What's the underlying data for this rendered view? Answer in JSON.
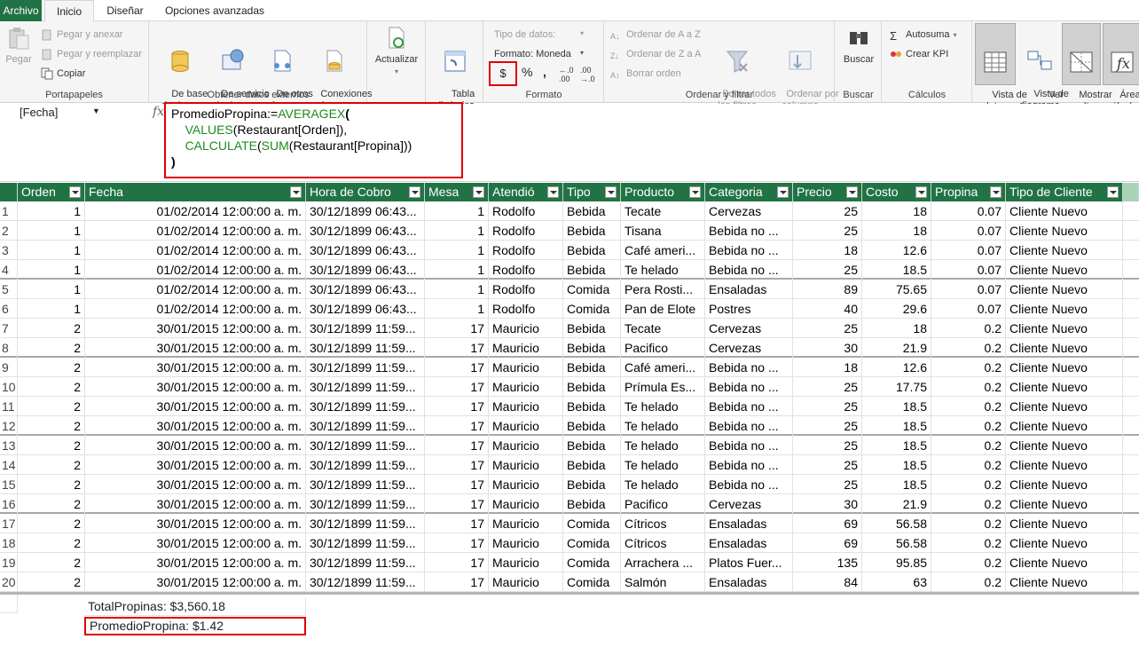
{
  "tabs": {
    "file": "Archivo",
    "home": "Inicio",
    "design": "Diseñar",
    "advanced": "Opciones avanzadas"
  },
  "ribbon": {
    "clipboard": {
      "paste": "Pegar",
      "paste_append": "Pegar y anexar",
      "paste_replace": "Pegar y reemplazar",
      "copy": "Copiar",
      "label": "Portapapeles"
    },
    "external": {
      "from_db": "De base\nde datos",
      "from_service": "De servicio\nde datos",
      "from_other": "De otros\norígenes",
      "existing": "Conexiones\nexistentes",
      "label": "Obtener datos externos"
    },
    "refresh": "Actualizar",
    "pivot": "Tabla\ndinámica",
    "format": {
      "data_type": "Tipo de datos:",
      "format": "Formato: Moneda",
      "currency": "$",
      "percent": "%",
      "comma": "͗",
      "label": "Formato"
    },
    "sort": {
      "asc": "Ordenar de A a Z",
      "desc": "Ordenar de Z a A",
      "clear": "Borrar orden",
      "clear_filters": "Borrar todos\nlos filtros",
      "by_column": "Ordenar por\ncolumna",
      "label": "Ordenar y filtrar"
    },
    "find": {
      "find": "Buscar",
      "label": "Buscar"
    },
    "calc": {
      "autosum": "Autosuma",
      "kpi": "Crear KPI",
      "label": "Cálculos"
    },
    "view": {
      "data_view": "Vista de\ndatos",
      "diagram_view": "Vista de\ndiagrama",
      "show_hidden": "Mostrar\noculto",
      "calc_area": "Área de\ncálculo",
      "label": "Ver"
    }
  },
  "formula_bar": {
    "name_box": "[Fecha]",
    "line1_name": "PromedioPropina:=",
    "line1_fn": "AVERAGEX",
    "line1_end": "(",
    "line2_fn": "VALUES",
    "line2_arg": "(Restaurant[Orden]),",
    "line3_fn1": "CALCULATE",
    "line3_mid": "(",
    "line3_fn2": "SUM",
    "line3_arg": "(Restaurant[Propina]))",
    "line4": ")"
  },
  "columns": [
    "Orden",
    "Fecha",
    "Hora de Cobro",
    "Mesa",
    "Atendió",
    "Tipo",
    "Producto",
    "Categoria",
    "Precio",
    "Costo",
    "Propina",
    "Tipo de Cliente"
  ],
  "rows": [
    [
      "1",
      "1",
      "01/02/2014 12:00:00 a. m.",
      "30/12/1899 06:43...",
      "1",
      "Rodolfo",
      "Bebida",
      "Tecate",
      "Cervezas",
      "25",
      "18",
      "0.07",
      "Cliente Nuevo"
    ],
    [
      "2",
      "1",
      "01/02/2014 12:00:00 a. m.",
      "30/12/1899 06:43...",
      "1",
      "Rodolfo",
      "Bebida",
      "Tisana",
      "Bebida no ...",
      "25",
      "18",
      "0.07",
      "Cliente Nuevo"
    ],
    [
      "3",
      "1",
      "01/02/2014 12:00:00 a. m.",
      "30/12/1899 06:43...",
      "1",
      "Rodolfo",
      "Bebida",
      "Café ameri...",
      "Bebida no ...",
      "18",
      "12.6",
      "0.07",
      "Cliente Nuevo"
    ],
    [
      "4",
      "1",
      "01/02/2014 12:00:00 a. m.",
      "30/12/1899 06:43...",
      "1",
      "Rodolfo",
      "Bebida",
      "Te helado",
      "Bebida no ...",
      "25",
      "18.5",
      "0.07",
      "Cliente Nuevo"
    ],
    [
      "5",
      "1",
      "01/02/2014 12:00:00 a. m.",
      "30/12/1899 06:43...",
      "1",
      "Rodolfo",
      "Comida",
      "Pera Rosti...",
      "Ensaladas",
      "89",
      "75.65",
      "0.07",
      "Cliente Nuevo"
    ],
    [
      "6",
      "1",
      "01/02/2014 12:00:00 a. m.",
      "30/12/1899 06:43...",
      "1",
      "Rodolfo",
      "Comida",
      "Pan de Elote",
      "Postres",
      "40",
      "29.6",
      "0.07",
      "Cliente Nuevo"
    ],
    [
      "7",
      "2",
      "30/01/2015 12:00:00 a. m.",
      "30/12/1899 11:59...",
      "17",
      "Mauricio",
      "Bebida",
      "Tecate",
      "Cervezas",
      "25",
      "18",
      "0.2",
      "Cliente Nuevo"
    ],
    [
      "8",
      "2",
      "30/01/2015 12:00:00 a. m.",
      "30/12/1899 11:59...",
      "17",
      "Mauricio",
      "Bebida",
      "Pacifico",
      "Cervezas",
      "30",
      "21.9",
      "0.2",
      "Cliente Nuevo"
    ],
    [
      "9",
      "2",
      "30/01/2015 12:00:00 a. m.",
      "30/12/1899 11:59...",
      "17",
      "Mauricio",
      "Bebida",
      "Café ameri...",
      "Bebida no ...",
      "18",
      "12.6",
      "0.2",
      "Cliente Nuevo"
    ],
    [
      "10",
      "2",
      "30/01/2015 12:00:00 a. m.",
      "30/12/1899 11:59...",
      "17",
      "Mauricio",
      "Bebida",
      "Prímula Es...",
      "Bebida no ...",
      "25",
      "17.75",
      "0.2",
      "Cliente Nuevo"
    ],
    [
      "11",
      "2",
      "30/01/2015 12:00:00 a. m.",
      "30/12/1899 11:59...",
      "17",
      "Mauricio",
      "Bebida",
      "Te helado",
      "Bebida no ...",
      "25",
      "18.5",
      "0.2",
      "Cliente Nuevo"
    ],
    [
      "12",
      "2",
      "30/01/2015 12:00:00 a. m.",
      "30/12/1899 11:59...",
      "17",
      "Mauricio",
      "Bebida",
      "Te helado",
      "Bebida no ...",
      "25",
      "18.5",
      "0.2",
      "Cliente Nuevo"
    ],
    [
      "13",
      "2",
      "30/01/2015 12:00:00 a. m.",
      "30/12/1899 11:59...",
      "17",
      "Mauricio",
      "Bebida",
      "Te helado",
      "Bebida no ...",
      "25",
      "18.5",
      "0.2",
      "Cliente Nuevo"
    ],
    [
      "14",
      "2",
      "30/01/2015 12:00:00 a. m.",
      "30/12/1899 11:59...",
      "17",
      "Mauricio",
      "Bebida",
      "Te helado",
      "Bebida no ...",
      "25",
      "18.5",
      "0.2",
      "Cliente Nuevo"
    ],
    [
      "15",
      "2",
      "30/01/2015 12:00:00 a. m.",
      "30/12/1899 11:59...",
      "17",
      "Mauricio",
      "Bebida",
      "Te helado",
      "Bebida no ...",
      "25",
      "18.5",
      "0.2",
      "Cliente Nuevo"
    ],
    [
      "16",
      "2",
      "30/01/2015 12:00:00 a. m.",
      "30/12/1899 11:59...",
      "17",
      "Mauricio",
      "Bebida",
      "Pacifico",
      "Cervezas",
      "30",
      "21.9",
      "0.2",
      "Cliente Nuevo"
    ],
    [
      "17",
      "2",
      "30/01/2015 12:00:00 a. m.",
      "30/12/1899 11:59...",
      "17",
      "Mauricio",
      "Comida",
      "Cítricos",
      "Ensaladas",
      "69",
      "56.58",
      "0.2",
      "Cliente Nuevo"
    ],
    [
      "18",
      "2",
      "30/01/2015 12:00:00 a. m.",
      "30/12/1899 11:59...",
      "17",
      "Mauricio",
      "Comida",
      "Cítricos",
      "Ensaladas",
      "69",
      "56.58",
      "0.2",
      "Cliente Nuevo"
    ],
    [
      "19",
      "2",
      "30/01/2015 12:00:00 a. m.",
      "30/12/1899 11:59...",
      "17",
      "Mauricio",
      "Comida",
      "Arrachera ...",
      "Platos Fuer...",
      "135",
      "95.85",
      "0.2",
      "Cliente Nuevo"
    ],
    [
      "20",
      "2",
      "30/01/2015 12:00:00 a. m.",
      "30/12/1899 11:59...",
      "17",
      "Mauricio",
      "Comida",
      "Salmón",
      "Ensaladas",
      "84",
      "63",
      "0.2",
      "Cliente Nuevo"
    ]
  ],
  "measures": {
    "total": "TotalPropinas: $3,560.18",
    "average": "PromedioPropina: $1.42"
  },
  "colors": {
    "header_green": "#217346",
    "highlight_red": "#e00000",
    "formula_fn": "#1e8a1e"
  }
}
